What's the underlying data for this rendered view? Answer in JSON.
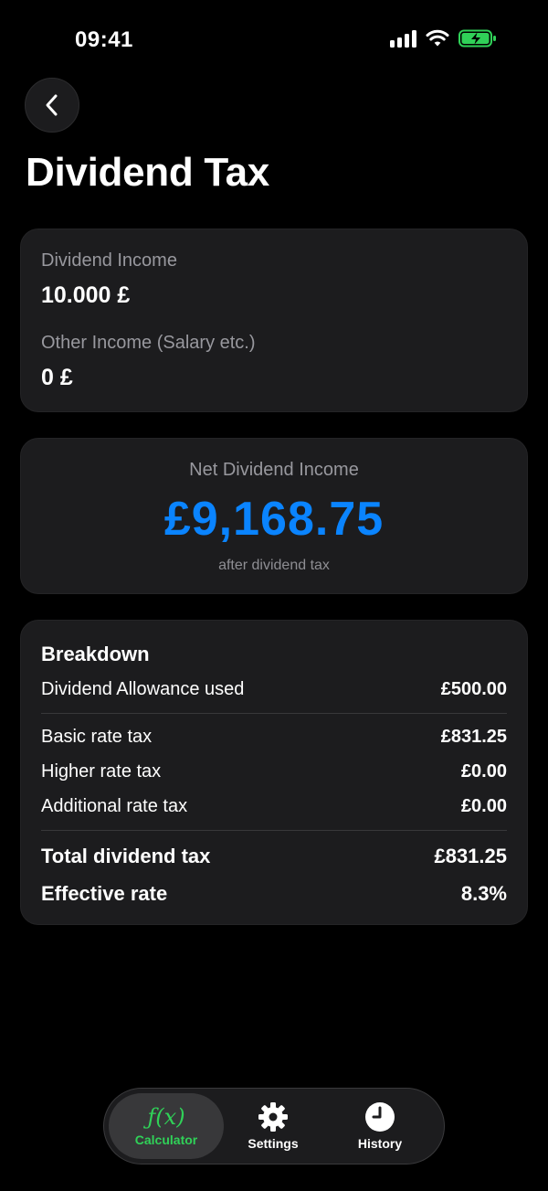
{
  "status_bar": {
    "time": "09:41"
  },
  "header": {
    "title": "Dividend Tax"
  },
  "inputs": [
    {
      "label": "Dividend Income",
      "value": "10.000 £"
    },
    {
      "label": "Other Income (Salary etc.)",
      "value": "0 £"
    }
  ],
  "result": {
    "label": "Net Dividend Income",
    "value": "£9,168.75",
    "subtitle": "after dividend tax",
    "accent_color": "#0a84ff"
  },
  "breakdown": {
    "heading": "Breakdown",
    "rows": [
      {
        "label": "Dividend Allowance used",
        "value": "£500.00"
      },
      {
        "label": "Basic rate tax",
        "value": "£831.25"
      },
      {
        "label": "Higher rate tax",
        "value": "£0.00"
      },
      {
        "label": "Additional rate tax",
        "value": "£0.00"
      }
    ],
    "totals": [
      {
        "label": "Total dividend tax",
        "value": "£831.25"
      },
      {
        "label": "Effective rate",
        "value": "8.3%"
      }
    ]
  },
  "tab_bar": {
    "active_color": "#30d158",
    "tabs": [
      {
        "label": "Calculator",
        "icon": "function-icon",
        "glyph": "ƒ(x)",
        "active": true
      },
      {
        "label": "Settings",
        "icon": "gear-icon",
        "active": false
      },
      {
        "label": "History",
        "icon": "clock-icon",
        "active": false
      }
    ]
  }
}
